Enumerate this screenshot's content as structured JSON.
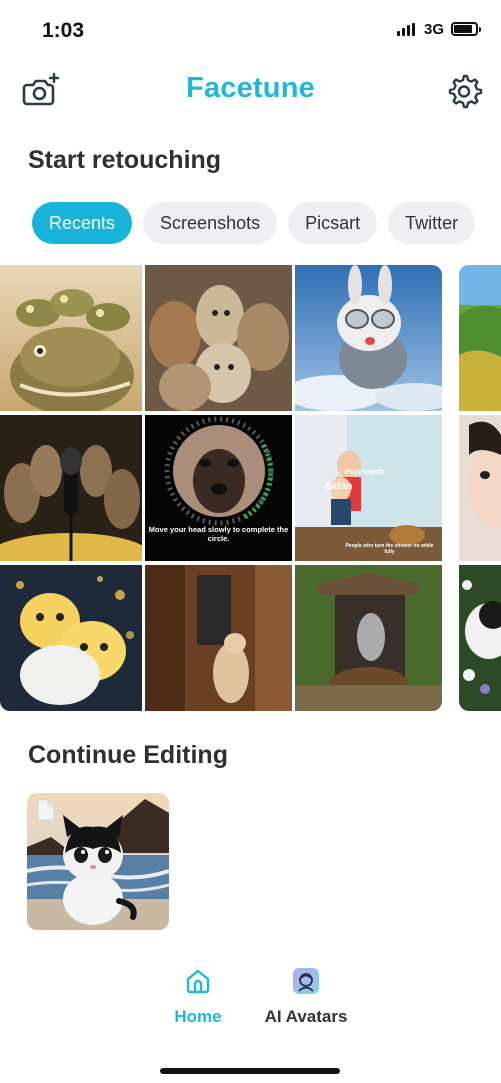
{
  "status": {
    "time": "1:03",
    "network": "3G"
  },
  "header": {
    "title": "Facetune",
    "left_icon": "camera-plus-icon",
    "right_icon": "gear-icon"
  },
  "retouch": {
    "title": "Start retouching",
    "chips": [
      {
        "label": "Recents",
        "active": true
      },
      {
        "label": "Screenshots",
        "active": false
      },
      {
        "label": "Picsart",
        "active": false
      },
      {
        "label": "Twitter",
        "active": false
      }
    ],
    "photos": [
      {
        "subject": "crocodile with frogs"
      },
      {
        "subject": "group of llamas"
      },
      {
        "subject": "bunny with goggles flying"
      },
      {
        "subject": "green landscape"
      },
      {
        "subject": "mice singing at microphone"
      },
      {
        "subject": "dog face scan",
        "caption": "Move your head slowly to complete the circle."
      },
      {
        "subject": "children against wall",
        "caption_top": "Psychopath",
        "caption_mid": "Satan",
        "caption_bottom": "People who turn the shower on while fully"
      },
      {
        "subject": "girl portrait"
      },
      {
        "subject": "hugging yellow kittens"
      },
      {
        "subject": "cat at door"
      },
      {
        "subject": "smoker in garden"
      },
      {
        "subject": "cat with flowers"
      }
    ]
  },
  "continue": {
    "title": "Continue Editing",
    "item": {
      "subject": "black and white kitten on beach"
    }
  },
  "tabs": [
    {
      "label": "Home",
      "icon": "home-icon",
      "active": true
    },
    {
      "label": "AI Avatars",
      "icon": "ai-avatars-icon",
      "active": false
    }
  ],
  "colors": {
    "accent": "#1eb8d8",
    "chip_bg": "#eeeff2",
    "text": "#2f2f2f"
  }
}
